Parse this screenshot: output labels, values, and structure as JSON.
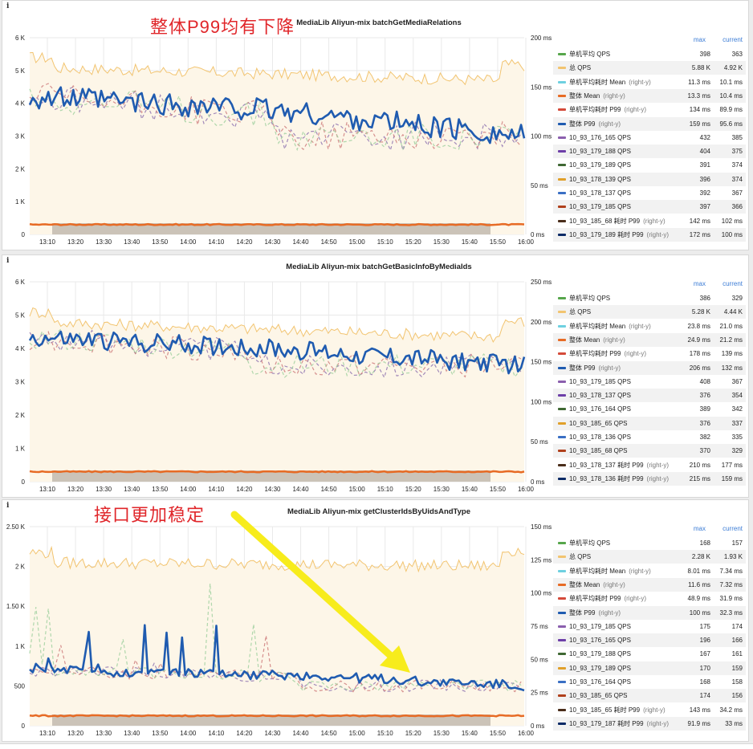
{
  "annotations": {
    "top": "整体P99均有下降",
    "bottom": "接口更加稳定"
  },
  "colors": {
    "qps_fill": "#fdf6e8",
    "qps_line": "#f2c470",
    "p99_line": "#1f5bb0",
    "mean_line": "#e76b25",
    "dash1": "#8b6fae",
    "dash2": "#c77",
    "dash3": "#9ccf9c",
    "axis_text": "#222",
    "grid": "#e9e9e9",
    "arrow": "#f7ec1c",
    "legend_header": "#3a7bd5"
  },
  "panels": [
    {
      "title": "MediaLib Aliyun-mix batchGetMediaRelations",
      "info_icon": "info-icon",
      "y_left": [
        "6 K",
        "5 K",
        "4 K",
        "3 K",
        "2 K",
        "1 K",
        "0"
      ],
      "y_right": [
        "200 ms",
        "150 ms",
        "100 ms",
        "50 ms",
        "0 ms"
      ],
      "x_ticks": [
        "13:10",
        "13:20",
        "13:30",
        "13:40",
        "13:50",
        "14:00",
        "14:10",
        "14:20",
        "14:30",
        "14:40",
        "14:50",
        "15:00",
        "15:10",
        "15:20",
        "15:30",
        "15:40",
        "15:50",
        "16:00"
      ],
      "legend_headers": {
        "max": "max",
        "current": "current"
      },
      "legend": [
        {
          "name": "单机平均 QPS",
          "axis": "",
          "max": "398",
          "current": "363",
          "color": "#56a64b"
        },
        {
          "name": "总 QPS",
          "axis": "",
          "max": "5.88 K",
          "current": "4.92 K",
          "color": "#f2c470"
        },
        {
          "name": "单机平均耗时 Mean",
          "axis": "(right-y)",
          "max": "11.3 ms",
          "current": "10.1 ms",
          "color": "#6ed0e0"
        },
        {
          "name": "整体 Mean",
          "axis": "(right-y)",
          "max": "13.3 ms",
          "current": "10.4 ms",
          "color": "#e76b25"
        },
        {
          "name": "单机平均耗时 P99",
          "axis": "(right-y)",
          "max": "134 ms",
          "current": "89.9 ms",
          "color": "#d44a3a"
        },
        {
          "name": "整体 P99",
          "axis": "(right-y)",
          "max": "159 ms",
          "current": "95.6 ms",
          "color": "#1f5bb0"
        },
        {
          "name": "10_93_176_165 QPS",
          "axis": "",
          "max": "432",
          "current": "385",
          "color": "#8b5fae"
        },
        {
          "name": "10_93_179_188 QPS",
          "axis": "",
          "max": "404",
          "current": "375",
          "color": "#6d3fa8"
        },
        {
          "name": "10_93_179_189 QPS",
          "axis": "",
          "max": "391",
          "current": "374",
          "color": "#3f6833"
        },
        {
          "name": "10_93_178_139 QPS",
          "axis": "",
          "max": "396",
          "current": "374",
          "color": "#e0a02a"
        },
        {
          "name": "10_93_178_137 QPS",
          "axis": "",
          "max": "392",
          "current": "367",
          "color": "#3a6fc4"
        },
        {
          "name": "10_93_179_185 QPS",
          "axis": "",
          "max": "397",
          "current": "366",
          "color": "#b0401c"
        },
        {
          "name": "10_93_185_68 耗时 P99",
          "axis": "(right-y)",
          "max": "142 ms",
          "current": "102 ms",
          "color": "#4a2d1a"
        },
        {
          "name": "10_93_179_189 耗时 P99",
          "axis": "(right-y)",
          "max": "172 ms",
          "current": "100 ms",
          "color": "#0a2a66"
        }
      ],
      "series_profile": {
        "qps_start": 0.85,
        "qps_end": 0.78,
        "p99_start": 0.7,
        "p99_end": 0.5,
        "p99_noise": 0.05,
        "p99_spike": 0,
        "step_at": 0.5
      }
    },
    {
      "title": "MediaLib Aliyun-mix batchGetBasicInfoByMediaIds",
      "info_icon": "info-icon",
      "y_left": [
        "6 K",
        "5 K",
        "4 K",
        "3 K",
        "2 K",
        "1 K",
        "0"
      ],
      "y_right": [
        "250 ms",
        "200 ms",
        "150 ms",
        "100 ms",
        "50 ms",
        "0 ms"
      ],
      "x_ticks": [
        "13:10",
        "13:20",
        "13:30",
        "13:40",
        "13:50",
        "14:00",
        "14:10",
        "14:20",
        "14:30",
        "14:40",
        "14:50",
        "15:00",
        "15:10",
        "15:20",
        "15:30",
        "15:40",
        "15:50",
        "16:00"
      ],
      "legend_headers": {
        "max": "max",
        "current": "current"
      },
      "legend": [
        {
          "name": "单机平均 QPS",
          "axis": "",
          "max": "386",
          "current": "329",
          "color": "#56a64b"
        },
        {
          "name": "总 QPS",
          "axis": "",
          "max": "5.28 K",
          "current": "4.44 K",
          "color": "#f2c470"
        },
        {
          "name": "单机平均耗时 Mean",
          "axis": "(right-y)",
          "max": "23.8 ms",
          "current": "21.0 ms",
          "color": "#6ed0e0"
        },
        {
          "name": "整体 Mean",
          "axis": "(right-y)",
          "max": "24.9 ms",
          "current": "21.2 ms",
          "color": "#e76b25"
        },
        {
          "name": "单机平均耗时 P99",
          "axis": "(right-y)",
          "max": "178 ms",
          "current": "139 ms",
          "color": "#d44a3a"
        },
        {
          "name": "整体 P99",
          "axis": "(right-y)",
          "max": "206 ms",
          "current": "132 ms",
          "color": "#1f5bb0"
        },
        {
          "name": "10_93_179_185 QPS",
          "axis": "",
          "max": "408",
          "current": "367",
          "color": "#8b5fae"
        },
        {
          "name": "10_93_178_137 QPS",
          "axis": "",
          "max": "376",
          "current": "354",
          "color": "#6d3fa8"
        },
        {
          "name": "10_93_176_164 QPS",
          "axis": "",
          "max": "389",
          "current": "342",
          "color": "#3f6833"
        },
        {
          "name": "10_93_185_65 QPS",
          "axis": "",
          "max": "376",
          "current": "337",
          "color": "#e0a02a"
        },
        {
          "name": "10_93_178_136 QPS",
          "axis": "",
          "max": "382",
          "current": "335",
          "color": "#3a6fc4"
        },
        {
          "name": "10_93_185_68 QPS",
          "axis": "",
          "max": "370",
          "current": "329",
          "color": "#b0401c"
        },
        {
          "name": "10_93_178_137 耗时 P99",
          "axis": "(right-y)",
          "max": "210 ms",
          "current": "177 ms",
          "color": "#4a2d1a"
        },
        {
          "name": "10_93_178_136 耗时 P99",
          "axis": "(right-y)",
          "max": "215 ms",
          "current": "159 ms",
          "color": "#0a2a66"
        }
      ],
      "series_profile": {
        "qps_start": 0.8,
        "qps_end": 0.72,
        "p99_start": 0.72,
        "p99_end": 0.58,
        "p99_noise": 0.04,
        "p99_spike": 0,
        "step_at": 0.45
      }
    },
    {
      "title": "MediaLib Aliyun-mix getClusterIdsByUidsAndType",
      "info_icon": "info-icon",
      "y_left": [
        "2.50 K",
        "2 K",
        "1.50 K",
        "1 K",
        "500",
        "0"
      ],
      "y_right": [
        "150 ms",
        "125 ms",
        "100 ms",
        "75 ms",
        "50 ms",
        "25 ms",
        "0 ms"
      ],
      "x_ticks": [
        "13:10",
        "13:20",
        "13:30",
        "13:40",
        "13:50",
        "14:00",
        "14:10",
        "14:20",
        "14:30",
        "14:40",
        "14:50",
        "15:00",
        "15:10",
        "15:20",
        "15:30",
        "15:40",
        "15:50",
        "16:00"
      ],
      "legend_headers": {
        "max": "max",
        "current": "current"
      },
      "legend": [
        {
          "name": "单机平均 QPS",
          "axis": "",
          "max": "168",
          "current": "157",
          "color": "#56a64b"
        },
        {
          "name": "总 QPS",
          "axis": "",
          "max": "2.28 K",
          "current": "1.93 K",
          "color": "#f2c470"
        },
        {
          "name": "单机平均耗时 Mean",
          "axis": "(right-y)",
          "max": "8.01 ms",
          "current": "7.34 ms",
          "color": "#6ed0e0"
        },
        {
          "name": "整体 Mean",
          "axis": "(right-y)",
          "max": "11.6 ms",
          "current": "7.32 ms",
          "color": "#e76b25"
        },
        {
          "name": "单机平均耗时 P99",
          "axis": "(right-y)",
          "max": "48.9 ms",
          "current": "31.9 ms",
          "color": "#d44a3a"
        },
        {
          "name": "整体 P99",
          "axis": "(right-y)",
          "max": "100 ms",
          "current": "32.3 ms",
          "color": "#1f5bb0"
        },
        {
          "name": "10_93_179_185 QPS",
          "axis": "",
          "max": "175",
          "current": "174",
          "color": "#8b5fae"
        },
        {
          "name": "10_93_176_165 QPS",
          "axis": "",
          "max": "196",
          "current": "166",
          "color": "#6d3fa8"
        },
        {
          "name": "10_93_179_188 QPS",
          "axis": "",
          "max": "167",
          "current": "161",
          "color": "#3f6833"
        },
        {
          "name": "10_93_179_189 QPS",
          "axis": "",
          "max": "170",
          "current": "159",
          "color": "#e0a02a"
        },
        {
          "name": "10_93_176_164 QPS",
          "axis": "",
          "max": "168",
          "current": "158",
          "color": "#3a6fc4"
        },
        {
          "name": "10_93_185_65 QPS",
          "axis": "",
          "max": "174",
          "current": "156",
          "color": "#b0401c"
        },
        {
          "name": "10_93_185_65 耗时 P99",
          "axis": "(right-y)",
          "max": "143 ms",
          "current": "34.2 ms",
          "color": "#4a2d1a"
        },
        {
          "name": "10_93_179_187 耗时 P99",
          "axis": "(right-y)",
          "max": "91.9 ms",
          "current": "33 ms",
          "color": "#0a2a66"
        }
      ],
      "series_profile": {
        "qps_start": 0.82,
        "qps_end": 0.8,
        "p99_start": 0.28,
        "p99_end": 0.2,
        "p99_noise": 0.02,
        "p99_spike": 0.45,
        "step_at": 0.55
      }
    }
  ]
}
